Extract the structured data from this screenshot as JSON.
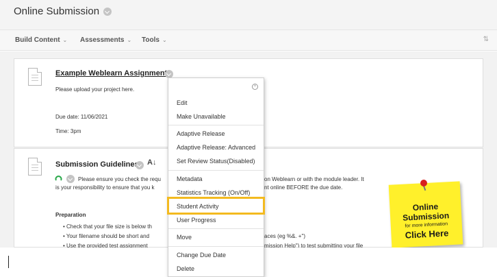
{
  "page": {
    "title": "Online Submission"
  },
  "toolbar": {
    "build_content": "Build Content",
    "assessments": "Assessments",
    "tools": "Tools"
  },
  "items": [
    {
      "title": "Example Weblearn Assignment",
      "description": "Please upload your project here.",
      "due_date": "Due date: 11/06/2021",
      "time": "Time: 3pm"
    },
    {
      "title": "Submission Guidelines",
      "line1_left": "Please ensure you check the requ",
      "line1_right": "on Weblearn or with the module leader. It",
      "line2_left": "is your responsibility to ensure that you k",
      "line2_right": "nt online BEFORE the due date.",
      "preparation_heading": "Preparation",
      "bullets": [
        "Check that your file size is below th",
        "Your filename should be short and",
        "Use the provided test assignment"
      ],
      "bullet2_tail": "aces (eg %&. +\")",
      "bullet3_tail": "mission Help\") to test submitting your file"
    }
  ],
  "context_menu": {
    "items": [
      "Edit",
      "Make Unavailable",
      "Adaptive Release",
      "Adaptive Release: Advanced",
      "Set Review Status(Disabled)",
      "Metadata",
      "Statistics Tracking (On/Off)",
      "Student Activity",
      "User Progress",
      "Move",
      "Change Due Date",
      "Delete"
    ],
    "highlighted": "Student Activity"
  },
  "sticky_note": {
    "line1": "Online",
    "line2": "Submission",
    "line3": "for more information",
    "line4": "Click Here",
    "color": "#fff02b"
  },
  "colors": {
    "highlight": "#f3ba1f",
    "pin": "#d81e1e"
  }
}
